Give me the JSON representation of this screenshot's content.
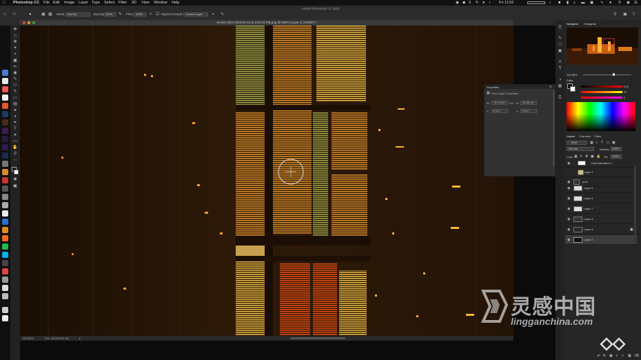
{
  "menubar": {
    "apple": "",
    "items": [
      "Photoshop CC",
      "File",
      "Edit",
      "Image",
      "Layer",
      "Type",
      "Select",
      "Filter",
      "3D",
      "View",
      "Window",
      "Help"
    ],
    "status_icons": [
      "creative-cloud-icon",
      "dropbox-icon",
      "notification-count",
      "clock-icon",
      "volume-icon",
      "battery-icon",
      "wifi-icon"
    ],
    "notification_count": "3",
    "clock": "Fri 11:52",
    "right_extras": [
      "search-icon",
      "siri-icon",
      "list-icon"
    ]
  },
  "window": {
    "app_title": "Adobe Photoshop CC 2018"
  },
  "options": {
    "mode_label": "Mode:",
    "mode_value": "Normal",
    "opacity_label": "Opacity:",
    "opacity_value": "100%",
    "flow_label": "Flow:",
    "flow_value": "100%",
    "aligned_label": "Aligned",
    "sample_label": "Sample:",
    "sample_value": "Current Layer"
  },
  "document": {
    "title": "Screen Shot 2018-02-13 at 3.03.16 PM.png @ 636% (Layer 2, RGB/8*) *",
    "zoom": "334.89%",
    "doc_size": "Doc: 36.2M/279.9M"
  },
  "properties": {
    "tab": "Properties",
    "header": "Pixel Layer Properties",
    "w_label": "W:",
    "w_value": "76.73 cm",
    "go_label": "GO",
    "h_label": "H:",
    "h_value": "32.86 cm",
    "x_label": "X:",
    "x_value": "0 cm",
    "y_label": "Y:",
    "y_value": "0 cm"
  },
  "navigator": {
    "tabs": [
      "Navigator",
      "Histogram"
    ],
    "zoom": "334.89%"
  },
  "color": {
    "tab": "Color",
    "r_value": "219",
    "g_value": "97",
    "b_value": "0",
    "accent": "#d66a00"
  },
  "layers_panel": {
    "tabs": [
      "Layers",
      "Channels",
      "Paths"
    ],
    "kind_label": "Kind",
    "blend_mode": "Normal",
    "opacity_label": "Opacity:",
    "opacity_value": "100%",
    "lock_label": "Lock:",
    "fill_label": "Fill:",
    "fill_value": "100%",
    "layers": [
      {
        "name": "Hue/Saturation 1"
      },
      {
        "name": "Layer 1"
      },
      {
        "name": "post"
      },
      {
        "name": "Layer 5"
      },
      {
        "name": "Layer 6"
      },
      {
        "name": "Layer 7"
      },
      {
        "name": "Layer 4"
      },
      {
        "name": "Layer 8"
      },
      {
        "name": "Layer 2"
      }
    ]
  },
  "watermark": {
    "brand_cn": "灵感中国",
    "brand_url": "lingganchina.com"
  }
}
